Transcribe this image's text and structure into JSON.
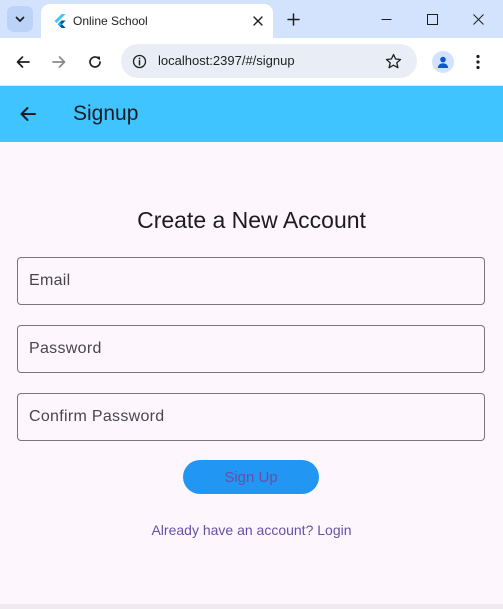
{
  "browser": {
    "tab_title": "Online School",
    "url": "localhost:2397/#/signup"
  },
  "icons": {
    "tab_search": "chevron-down-icon",
    "favicon": "flutter-logo-icon",
    "tab_close": "close-icon",
    "new_tab": "plus-icon",
    "minimize": "minimize-icon",
    "maximize": "maximize-icon",
    "close_window": "close-icon",
    "back": "arrow-left-icon",
    "forward": "arrow-right-icon",
    "reload": "reload-icon",
    "site_info": "info-icon",
    "bookmark": "star-icon",
    "profile": "person-icon",
    "menu": "kebab-menu-icon",
    "app_back": "arrow-left-icon"
  },
  "colors": {
    "appbar": "#40c4ff",
    "primary_button": "#2196f3",
    "accent_text": "#6750a4",
    "page_background": "#fdf7fd"
  },
  "app": {
    "title": "Signup",
    "heading": "Create a New Account",
    "fields": {
      "email_placeholder": "Email",
      "password_placeholder": "Password",
      "confirm_password_placeholder": "Confirm Password"
    },
    "signup_button": "Sign Up",
    "login_link": "Already have an account? Login"
  }
}
